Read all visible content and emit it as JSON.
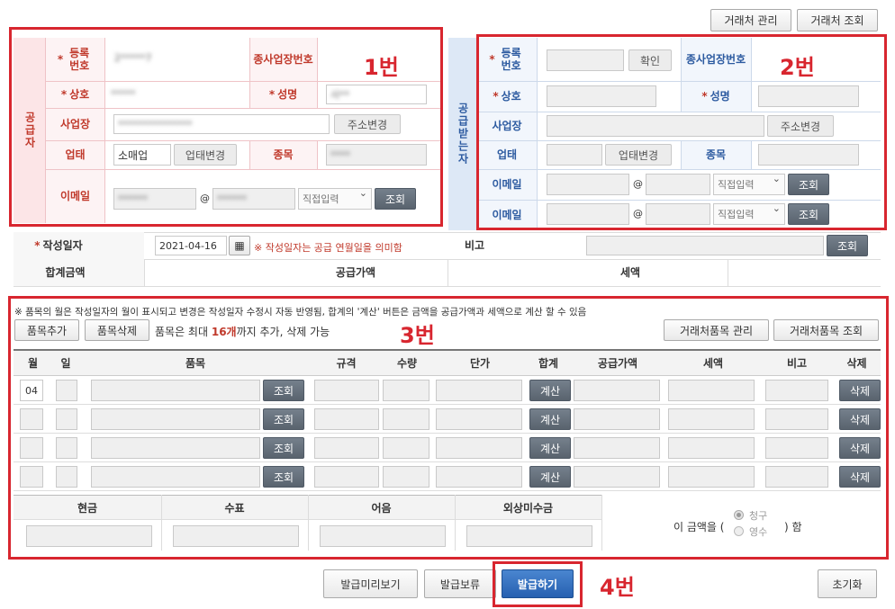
{
  "top_buttons": {
    "partner_manage": "거래처 관리",
    "partner_search": "거래처 조회"
  },
  "supplier": {
    "section_label": "공급자",
    "reg_no_label": "등록번호",
    "reg_no_value": "2*****7",
    "sub_biz_label": "종사업장번호",
    "company_label": "상호",
    "company_value": "*****",
    "name_label": "성명",
    "name_value": "사**",
    "address_label": "사업장",
    "address_value": "***************",
    "address_change": "주소변경",
    "biz_type_label": "업태",
    "biz_type_value": "소매업",
    "biz_type_change": "업태변경",
    "item_label": "종목",
    "item_value": "****",
    "email_label": "이메일",
    "email_id": "******",
    "email_domain": "******",
    "email_select": "직접입력",
    "lookup": "조회"
  },
  "receiver": {
    "section_label": "공급받는자",
    "reg_no_label": "등록번호",
    "confirm": "확인",
    "sub_biz_label": "종사업장번호",
    "company_label": "상호",
    "name_label": "성명",
    "address_label": "사업장",
    "address_change": "주소변경",
    "biz_type_label": "업태",
    "biz_type_change": "업태변경",
    "item_label": "종목",
    "email_label": "이메일",
    "email_label2": "이메일",
    "email_select": "직접입력",
    "lookup": "조회"
  },
  "at": "@",
  "date_row": {
    "label": "작성일자",
    "value": "2021-04-16",
    "note": "※ 작성일자는 공급 연월일을 의미함",
    "remark_label": "비고",
    "lookup": "조회"
  },
  "totals_row": {
    "total_label": "합계금액",
    "supply_label": "공급가액",
    "tax_label": "세액"
  },
  "items": {
    "notice": "※ 품목의 월은 작성일자의 월이 표시되고 변경은 작성일자 수정시 자동 반영됨, 합계의 '계산' 버튼은 금액을 공급가액과 세액으로 계산 할 수 있음",
    "add": "품목추가",
    "delete": "품목삭제",
    "limit_prefix": "품목은 최대 ",
    "limit_count": "16개",
    "limit_suffix": "까지 추가, 삭제 가능",
    "partner_items_manage": "거래처품목 관리",
    "partner_items_search": "거래처품목 조회",
    "headers": [
      "월",
      "일",
      "품목",
      "규격",
      "수량",
      "단가",
      "합계",
      "공급가액",
      "세액",
      "비고",
      "삭제"
    ],
    "rows": [
      {
        "month": "04",
        "lookup": "조회",
        "calc": "계산",
        "del": "삭제"
      },
      {
        "month": "",
        "lookup": "조회",
        "calc": "계산",
        "del": "삭제"
      },
      {
        "month": "",
        "lookup": "조회",
        "calc": "계산",
        "del": "삭제"
      },
      {
        "month": "",
        "lookup": "조회",
        "calc": "계산",
        "del": "삭제"
      }
    ]
  },
  "payment": {
    "cash": "현금",
    "check": "수표",
    "note": "어음",
    "credit": "외상미수금",
    "amount_prefix": "이 금액을 (",
    "claim": "청구",
    "receipt": "영수",
    "amount_suffix": ") 함"
  },
  "bottom": {
    "preview": "발급미리보기",
    "hold": "발급보류",
    "issue": "발급하기",
    "reset": "초기화"
  },
  "annotations": {
    "n1": "1번",
    "n2": "2번",
    "n3": "3번",
    "n4": "4번"
  }
}
